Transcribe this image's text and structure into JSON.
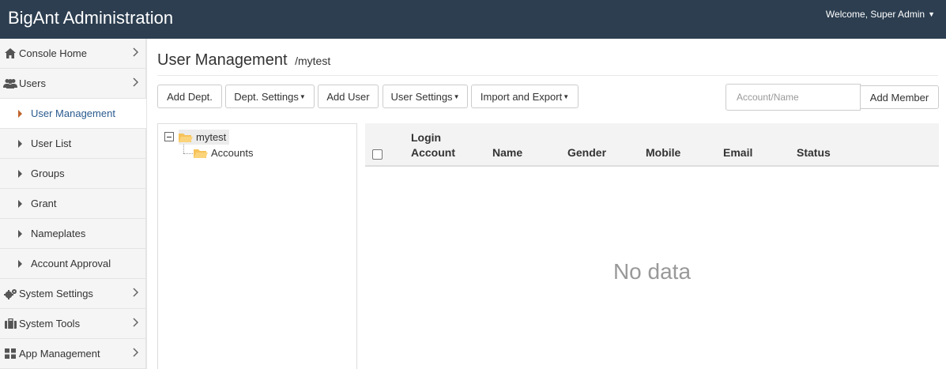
{
  "app": {
    "title": "BigAnt Administration",
    "welcome": "Welcome, Super Admin"
  },
  "sidebar": {
    "items": [
      {
        "label": "Console Home",
        "icon": "home-icon"
      },
      {
        "label": "Users",
        "icon": "users-icon"
      },
      {
        "label": "System Settings",
        "icon": "gears-icon"
      },
      {
        "label": "System Tools",
        "icon": "briefcase-icon"
      },
      {
        "label": "App Management",
        "icon": "grid-icon"
      }
    ],
    "sub_items": [
      {
        "label": "User Management",
        "active": true
      },
      {
        "label": "User List"
      },
      {
        "label": "Groups"
      },
      {
        "label": "Grant"
      },
      {
        "label": "Nameplates"
      },
      {
        "label": "Account Approval"
      }
    ]
  },
  "main": {
    "title": "User Management",
    "path": "/mytest",
    "toolbar": {
      "add_dept": "Add Dept.",
      "dept_settings": "Dept. Settings",
      "add_user": "Add User",
      "user_settings": "User Settings",
      "import_export": "Import and Export",
      "search_placeholder": "Account/Name",
      "add_member": "Add Member"
    },
    "tree": {
      "root": "mytest",
      "child": "Accounts"
    },
    "table": {
      "columns": [
        "Login Account",
        "Name",
        "Gender",
        "Mobile",
        "Email",
        "Status"
      ],
      "col_login_line1": "Login",
      "col_login_line2": "Account",
      "col_name": "Name",
      "col_gender": "Gender",
      "col_mobile": "Mobile",
      "col_email": "Email",
      "col_status": "Status",
      "rows": [],
      "empty_text": "No data"
    }
  },
  "colors": {
    "topbar": "#2c3e50",
    "active_text": "#2a5b8f",
    "active_marker": "#c0642b",
    "folder": "#f6c35a"
  }
}
